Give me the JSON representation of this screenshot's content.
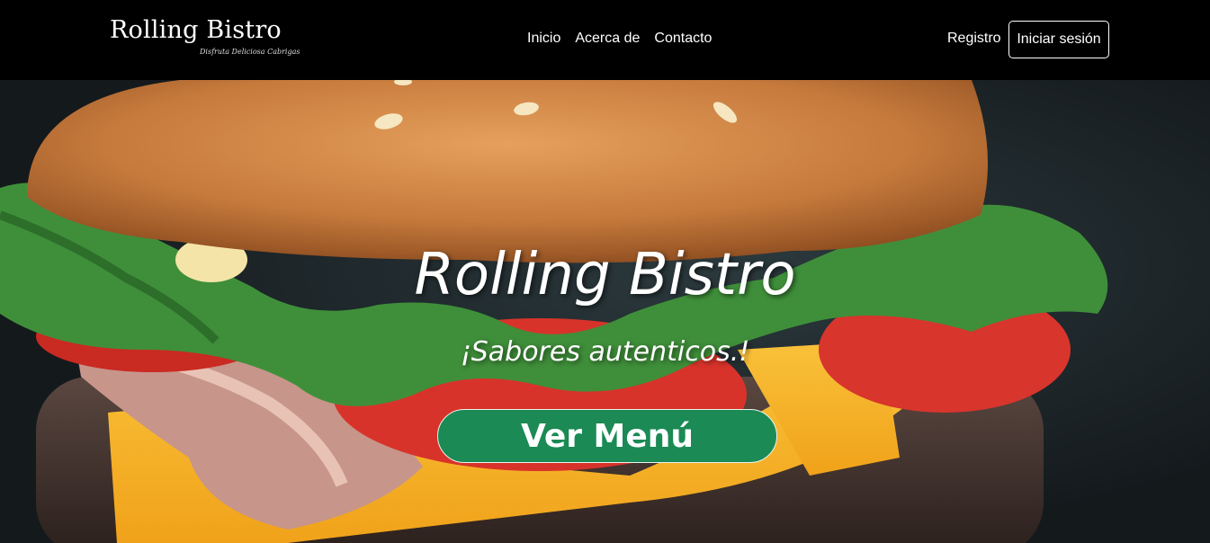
{
  "navbar": {
    "brand": {
      "name": "Rolling Bistro",
      "tagline": "Disfruta Deliciosa Cabrigas"
    },
    "links": [
      {
        "label": "Inicio"
      },
      {
        "label": "Acerca de"
      },
      {
        "label": "Contacto"
      }
    ],
    "register_label": "Registro",
    "login_label": "Iniciar sesión"
  },
  "hero": {
    "title": "Rolling Bistro",
    "subtitle": "¡Sabores autenticos.!",
    "cta_label": "Ver Menú",
    "image": "burger-photo"
  },
  "colors": {
    "navbar_bg": "#000000",
    "cta_bg": "#1b8a55",
    "text": "#ffffff"
  }
}
